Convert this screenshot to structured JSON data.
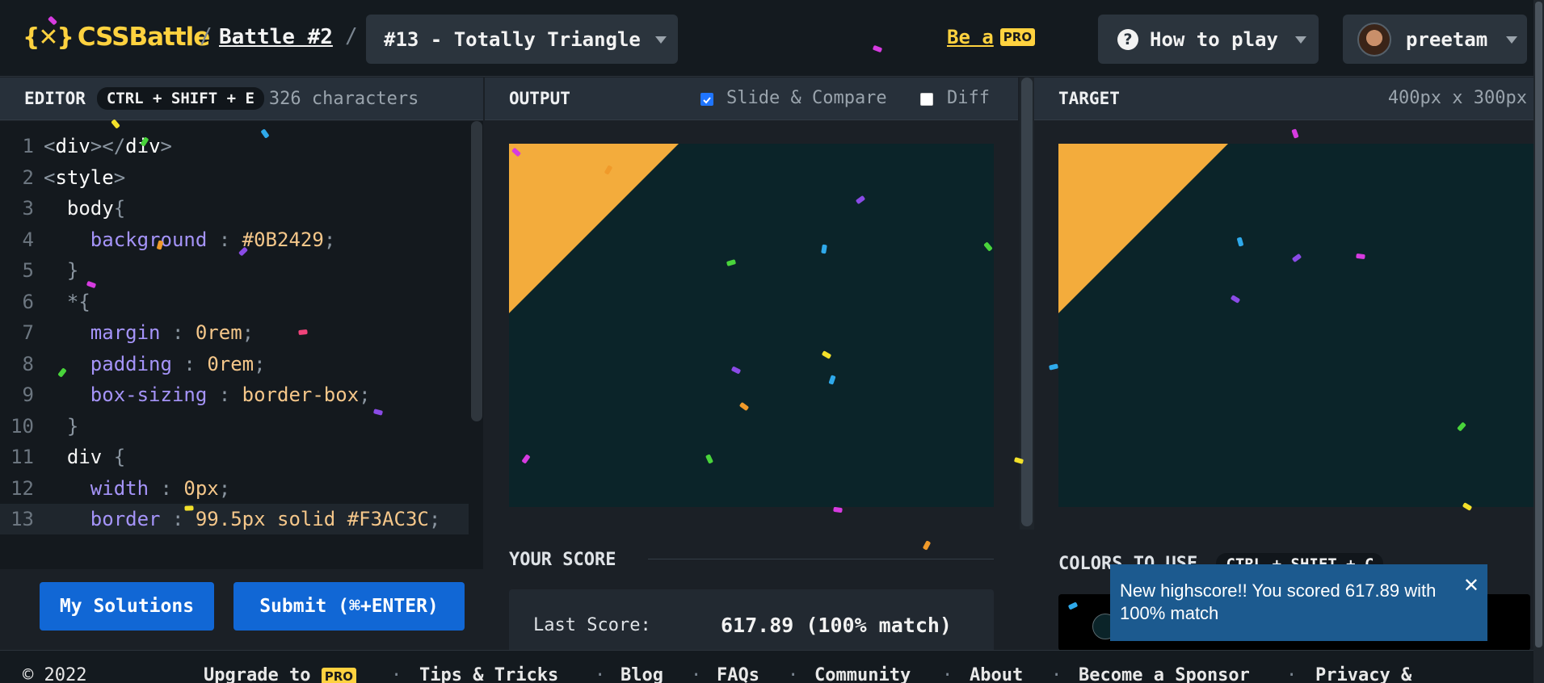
{
  "header": {
    "logo_mark": "{✕}",
    "logo_text": "CSSBattle",
    "crumb_sep": "/",
    "battle_link": "Battle #2",
    "battle_select": "#13 - Totally Triangle",
    "be_a_pro": "Be a",
    "pro_badge": "PRO",
    "how_to_play": "How to play",
    "help_icon_glyph": "?",
    "username": "preetam"
  },
  "editor": {
    "title": "EDITOR",
    "shortcut": "CTRL + SHIFT + E",
    "char_count": "326 characters",
    "lines": [
      {
        "n": "1",
        "segs": [
          [
            "tg",
            "<"
          ],
          [
            "tn",
            "div"
          ],
          [
            "tg",
            "></"
          ],
          [
            "tn",
            "div"
          ],
          [
            "tg",
            ">"
          ]
        ]
      },
      {
        "n": "2",
        "segs": [
          [
            "tg",
            "<"
          ],
          [
            "tn",
            "style"
          ],
          [
            "tg",
            ">"
          ]
        ]
      },
      {
        "n": "3",
        "segs": [
          [
            "sel",
            "  body"
          ],
          [
            "tg",
            "{"
          ]
        ]
      },
      {
        "n": "4",
        "segs": [
          [
            "prop",
            "    background"
          ],
          [
            "tg",
            " : "
          ],
          [
            "val",
            "#0B2429"
          ],
          [
            "tg",
            ";"
          ]
        ]
      },
      {
        "n": "5",
        "segs": [
          [
            "tg",
            "  }"
          ]
        ]
      },
      {
        "n": "6",
        "segs": [
          [
            "tg",
            "  *{"
          ]
        ]
      },
      {
        "n": "7",
        "segs": [
          [
            "prop",
            "    margin"
          ],
          [
            "tg",
            " : "
          ],
          [
            "val",
            "0rem"
          ],
          [
            "tg",
            ";"
          ]
        ]
      },
      {
        "n": "8",
        "segs": [
          [
            "prop",
            "    padding"
          ],
          [
            "tg",
            " : "
          ],
          [
            "val",
            "0rem"
          ],
          [
            "tg",
            ";"
          ]
        ]
      },
      {
        "n": "9",
        "segs": [
          [
            "prop",
            "    box-sizing"
          ],
          [
            "tg",
            " : "
          ],
          [
            "val",
            "border-box"
          ],
          [
            "tg",
            ";"
          ]
        ]
      },
      {
        "n": "10",
        "segs": [
          [
            "tg",
            "  }"
          ]
        ]
      },
      {
        "n": "11",
        "segs": [
          [
            "sel",
            "  div "
          ],
          [
            "tg",
            "{"
          ]
        ]
      },
      {
        "n": "12",
        "segs": [
          [
            "prop",
            "    width"
          ],
          [
            "tg",
            " : "
          ],
          [
            "val",
            "0px"
          ],
          [
            "tg",
            ";"
          ]
        ]
      },
      {
        "n": "13",
        "segs": [
          [
            "prop",
            "    border"
          ],
          [
            "tg",
            " : "
          ],
          [
            "val",
            "99.5px solid #F3AC3C"
          ],
          [
            "tg",
            ";"
          ]
        ]
      }
    ],
    "my_solutions": "My Solutions",
    "submit": "Submit (⌘+ENTER)"
  },
  "output": {
    "title": "OUTPUT",
    "slide_compare": "Slide & Compare",
    "slide_compare_checked": true,
    "diff": "Diff",
    "diff_checked": false,
    "your_score": "YOUR SCORE",
    "last_score_label": "Last Score:",
    "last_score_value": "617.89 (100% match)"
  },
  "target": {
    "title": "TARGET",
    "size": "400px x 300px",
    "colors_to_use": "COLORS TO USE",
    "colors_shortcut": "CTRL + SHIFT + C"
  },
  "canvas_colors": {
    "background": "#0B2429",
    "triangle": "#F3AC3C"
  },
  "toast": {
    "message": "New highscore!! You scored 617.89 with 100% match",
    "close": "✕"
  },
  "footer": {
    "copyright": "© 2022",
    "upgrade": "Upgrade to",
    "pro_badge": "PRO",
    "sep": "·",
    "links": [
      "Tips & Tricks",
      "Blog",
      "FAQs",
      "Community",
      "About",
      "Become a Sponsor",
      "Privacy &"
    ]
  },
  "colors": {
    "accent_yellow": "#ffd23f",
    "button_blue": "#1167d5",
    "toast_blue": "#1c5a8f"
  }
}
